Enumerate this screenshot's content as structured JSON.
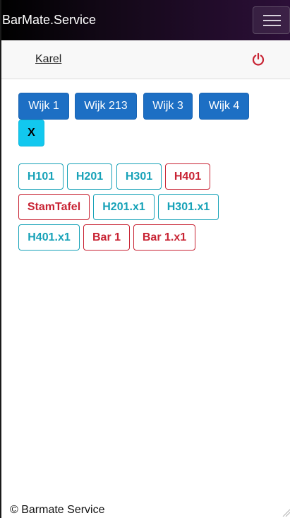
{
  "app": {
    "title": "BarMate.Service"
  },
  "user": {
    "name": "Karel",
    "logout_icon": "power-icon"
  },
  "neighborhoods": [
    "Wijk 1",
    "Wijk 213",
    "Wijk 3",
    "Wijk 4"
  ],
  "clear_label": "X",
  "tables": [
    {
      "label": "H101",
      "status": "cyan"
    },
    {
      "label": "H201",
      "status": "cyan"
    },
    {
      "label": "H301",
      "status": "cyan"
    },
    {
      "label": "H401",
      "status": "red"
    },
    {
      "label": "StamTafel",
      "status": "red"
    },
    {
      "label": "H201.x1",
      "status": "cyan"
    },
    {
      "label": "H301.x1",
      "status": "cyan"
    },
    {
      "label": "H401.x1",
      "status": "cyan"
    },
    {
      "label": "Bar 1",
      "status": "red"
    },
    {
      "label": "Bar 1.x1",
      "status": "red"
    }
  ],
  "footer": {
    "text": "© Barmate Service"
  },
  "colors": {
    "primary": "#1d6fc4",
    "info": "#17a2b8",
    "danger": "#c82333",
    "clear": "#12c8ef"
  }
}
